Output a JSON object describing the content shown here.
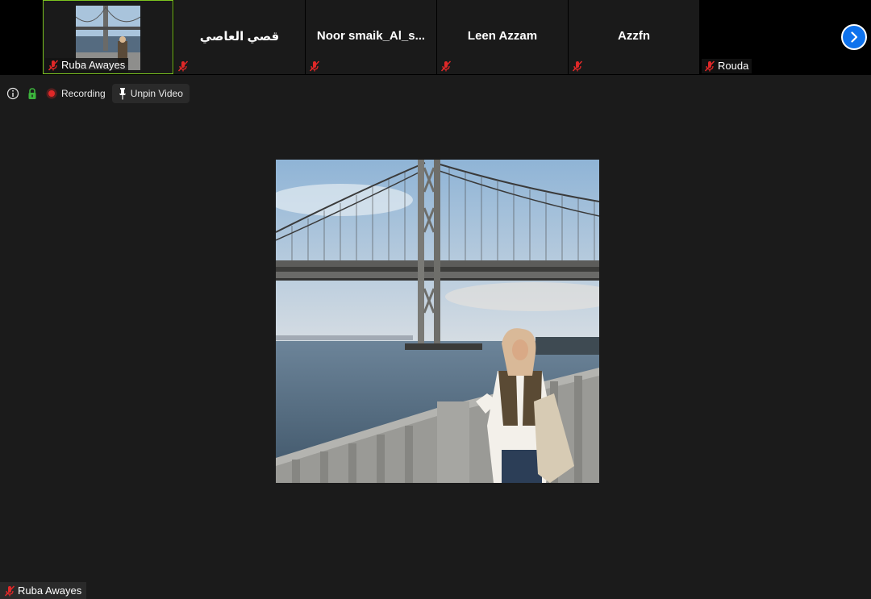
{
  "participants": [
    {
      "name": "Ruba Awayes",
      "muted": true,
      "has_video": true,
      "active": true
    },
    {
      "name": "قصي العاصي",
      "muted": true,
      "has_video": false
    },
    {
      "name": "Noor  smaik_Al_s...",
      "muted": true,
      "has_video": false
    },
    {
      "name": "Leen Azzam",
      "muted": true,
      "has_video": false
    },
    {
      "name": "Azzfn",
      "muted": true,
      "has_video": false
    },
    {
      "name": "Rouda",
      "muted": true,
      "has_video": false,
      "name_tag": true
    }
  ],
  "toolbar": {
    "info_icon": "info-icon",
    "security_icon": "lock-icon",
    "recording_label": "Recording",
    "unpin_label": "Unpin Video"
  },
  "main_video": {
    "speaker_name": "Ruba Awayes",
    "muted": true
  },
  "colors": {
    "accent": "#0e72ed",
    "active_border": "#7cc41f",
    "muted_red": "#e02828",
    "recording_red": "#e02828",
    "lock_green": "#3cb43c"
  }
}
